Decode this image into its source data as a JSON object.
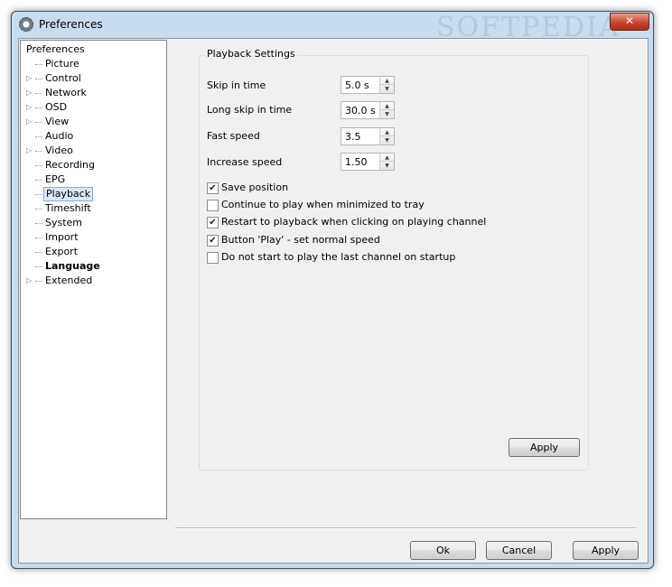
{
  "window": {
    "title": "Preferences",
    "close_symbol": "✕"
  },
  "tree": {
    "root": "Preferences",
    "items": [
      {
        "label": "Picture",
        "expandable": false
      },
      {
        "label": "Control",
        "expandable": true
      },
      {
        "label": "Network",
        "expandable": true
      },
      {
        "label": "OSD",
        "expandable": true
      },
      {
        "label": "View",
        "expandable": true
      },
      {
        "label": "Audio",
        "expandable": false
      },
      {
        "label": "Video",
        "expandable": true
      },
      {
        "label": "Recording",
        "expandable": false
      },
      {
        "label": "EPG",
        "expandable": false
      },
      {
        "label": "Playback",
        "expandable": false,
        "selected": true
      },
      {
        "label": "Timeshift",
        "expandable": false
      },
      {
        "label": "System",
        "expandable": false
      },
      {
        "label": "Import",
        "expandable": false
      },
      {
        "label": "Export",
        "expandable": false
      },
      {
        "label": "Language",
        "expandable": false,
        "bold": true
      },
      {
        "label": "Extended",
        "expandable": true
      }
    ]
  },
  "playback": {
    "group_title": "Playback Settings",
    "fields": [
      {
        "label": "Skip in time",
        "value": "5.0 s"
      },
      {
        "label": "Long skip in time",
        "value": "30.0 s"
      },
      {
        "label": "Fast speed",
        "value": "3.5"
      },
      {
        "label": "Increase speed",
        "value": "1.50"
      }
    ],
    "checkboxes": [
      {
        "label": "Save position",
        "checked": true
      },
      {
        "label": "Continue to play when minimized to tray",
        "checked": false
      },
      {
        "label": "Restart to playback when clicking on playing channel",
        "checked": true
      },
      {
        "label": "Button 'Play' - set normal speed",
        "checked": true
      },
      {
        "label": "Do not start to play the last channel on startup",
        "checked": false
      }
    ],
    "apply_label": "Apply"
  },
  "footer": {
    "ok_label": "Ok",
    "cancel_label": "Cancel",
    "apply_label": "Apply"
  },
  "watermark": "SOFTPEDIA",
  "colors": {
    "window_frame": "#c8dcef",
    "client_bg": "#f0f0f0",
    "selection": "#d8e9fb"
  }
}
